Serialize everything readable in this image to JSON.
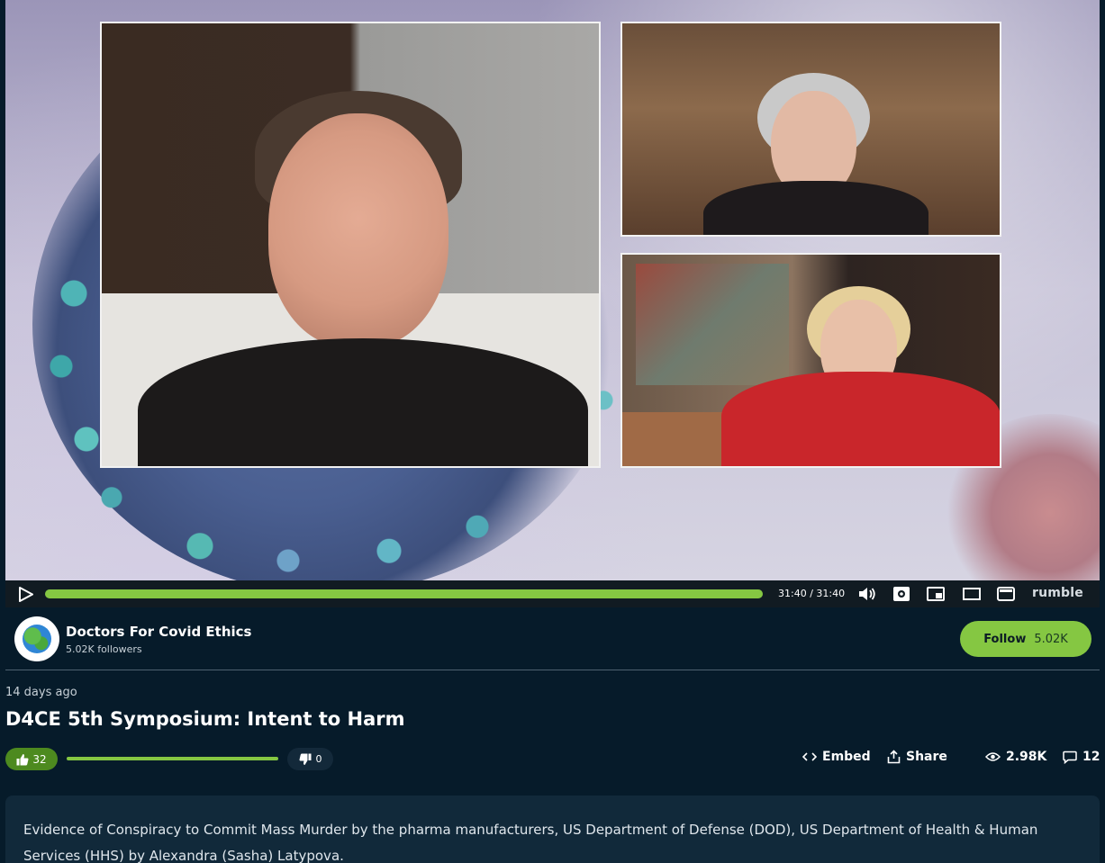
{
  "player": {
    "progress_fraction": 1.0,
    "time": "31:40 / 31:40",
    "brand": "rumble"
  },
  "channel": {
    "name": "Doctors For Covid Ethics",
    "followers": "5.02K followers",
    "follow_label": "Follow",
    "follow_count": "5.02K"
  },
  "video": {
    "posted": "14 days ago",
    "title": "D4CE 5th Symposium: Intent to Harm",
    "likes": "32",
    "dislikes": "0",
    "like_ratio": 1.0,
    "embed_label": "Embed",
    "share_label": "Share",
    "views": "2.98K",
    "comments": "12",
    "description": "Evidence of Conspiracy to Commit Mass Murder by the pharma manufacturers, US Department of Defense (DOD), US Department of Health & Human Services (HHS) by Alexandra (Sasha) Latypova."
  },
  "colors": {
    "accent": "#85c742",
    "background": "#061b2a",
    "card": "#11293a"
  },
  "icons": {
    "play": "play-icon",
    "volume": "volume-icon",
    "settings": "settings-icon",
    "pip": "picture-in-picture-icon",
    "theater": "theater-mode-icon",
    "fullscreen": "fullscreen-icon",
    "like": "thumbs-up-icon",
    "dislike": "thumbs-down-icon",
    "embed": "embed-code-icon",
    "share": "share-icon",
    "views": "eye-icon",
    "comments": "comment-icon"
  }
}
